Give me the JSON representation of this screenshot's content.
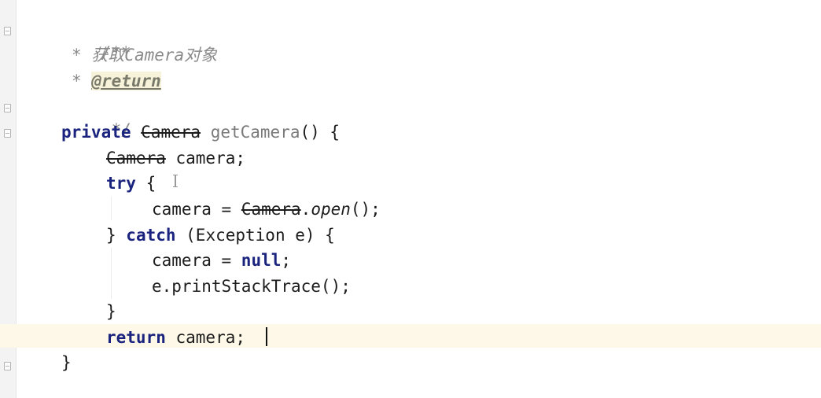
{
  "editor": {
    "lines": {
      "l1_comment_open": "/**",
      "l2_star": "* ",
      "l2_desc": "获取Camera对象",
      "l3_star": "* ",
      "l3_tag": "@return",
      "l4_comment_close": "*/",
      "l5_kw_private": "private",
      "l5_type": "Camera",
      "l5_method": "getCamera",
      "l5_rest": "() {",
      "l6_type": "Camera",
      "l6_rest": " camera;",
      "l7_kw_try": "try",
      "l7_rest": " {",
      "l8_lhs": "camera = ",
      "l8_class": "Camera",
      "l8_dot": ".",
      "l8_static": "open",
      "l8_rest": "();",
      "l9_brace": "} ",
      "l9_kw_catch": "catch",
      "l9_rest": " (Exception e) {",
      "l10_lhs": "camera = ",
      "l10_kw_null": "null",
      "l10_semi": ";",
      "l11_stmt": "e.printStackTrace();",
      "l12_brace": "}",
      "l13_kw_return": "return",
      "l13_rest": " camera;",
      "l14_brace": "}"
    }
  }
}
